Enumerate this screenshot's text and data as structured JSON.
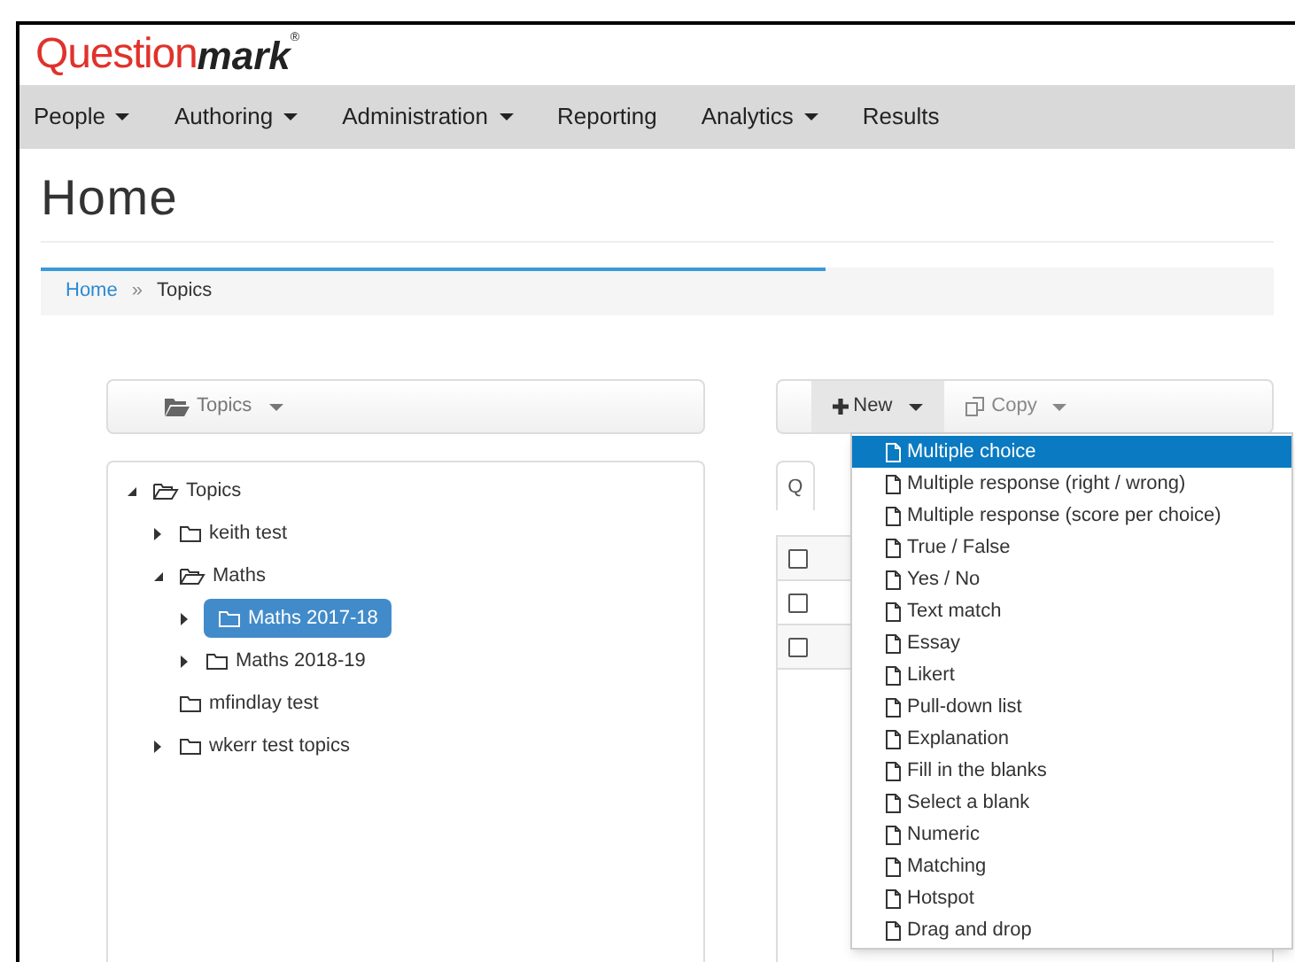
{
  "logo": {
    "part_1": "Question",
    "part_2": "mark",
    "mark": "®"
  },
  "nav": [
    {
      "label": "People",
      "dropdown": true
    },
    {
      "label": "Authoring",
      "dropdown": true
    },
    {
      "label": "Administration",
      "dropdown": true
    },
    {
      "label": "Reporting",
      "dropdown": false
    },
    {
      "label": "Analytics",
      "dropdown": true
    },
    {
      "label": "Results",
      "dropdown": false
    }
  ],
  "page_title": "Home",
  "breadcrumb": [
    {
      "label": "Home",
      "link": true
    },
    {
      "label": "Topics",
      "link": false
    }
  ],
  "breadcrumb_separator": "»",
  "left_toolbar": {
    "label": "Topics"
  },
  "tree": [
    {
      "label": "Topics",
      "expanded": true,
      "selected": false,
      "has_children": true,
      "children": [
        {
          "label": "keith test",
          "expanded": false,
          "selected": false,
          "has_children": true
        },
        {
          "label": "Maths",
          "expanded": true,
          "selected": false,
          "has_children": true,
          "children": [
            {
              "label": "Maths 2017-18",
              "expanded": false,
              "selected": true,
              "has_children": true
            },
            {
              "label": "Maths 2018-19",
              "expanded": false,
              "selected": false,
              "has_children": true
            }
          ]
        },
        {
          "label": "mfindlay test",
          "expanded": false,
          "selected": false,
          "has_children": false
        },
        {
          "label": "wkerr test topics",
          "expanded": false,
          "selected": false,
          "has_children": true
        }
      ]
    }
  ],
  "right_toolbar": {
    "buttons": [
      {
        "label": "New",
        "kind": "new",
        "active": true
      },
      {
        "label": "Copy",
        "kind": "copy",
        "active": false
      }
    ]
  },
  "tab_partial": "Q",
  "table_rows": [
    {
      "checked": false
    },
    {
      "checked": false
    },
    {
      "checked": false
    }
  ],
  "new_menu": [
    {
      "label": "Multiple choice",
      "selected": true
    },
    {
      "label": "Multiple response (right / wrong)",
      "selected": false
    },
    {
      "label": "Multiple response (score per choice)",
      "selected": false
    },
    {
      "label": "True / False",
      "selected": false
    },
    {
      "label": "Yes / No",
      "selected": false
    },
    {
      "label": "Text match",
      "selected": false
    },
    {
      "label": "Essay",
      "selected": false
    },
    {
      "label": "Likert",
      "selected": false
    },
    {
      "label": "Pull-down list",
      "selected": false
    },
    {
      "label": "Explanation",
      "selected": false
    },
    {
      "label": "Fill in the blanks",
      "selected": false
    },
    {
      "label": "Select a blank",
      "selected": false
    },
    {
      "label": "Numeric",
      "selected": false
    },
    {
      "label": "Matching",
      "selected": false
    },
    {
      "label": "Hotspot",
      "selected": false
    },
    {
      "label": "Drag and drop",
      "selected": false
    }
  ]
}
